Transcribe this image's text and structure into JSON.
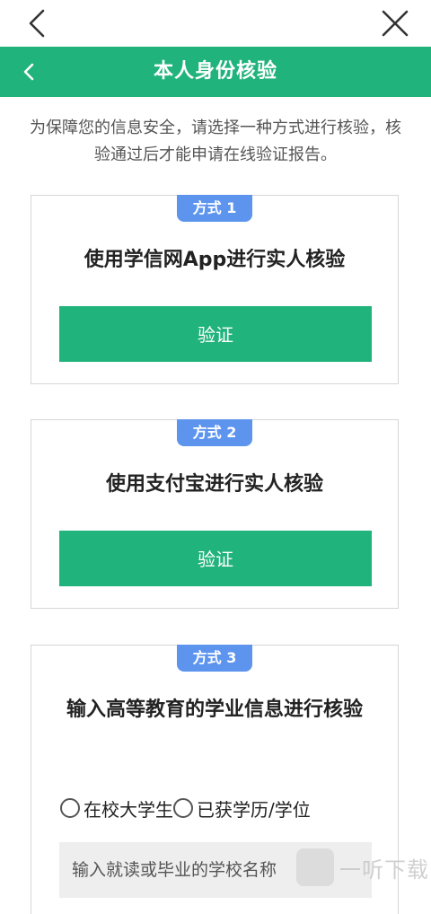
{
  "header": {
    "title": "本人身份核验"
  },
  "intro": {
    "text": "为保障您的信息安全，请选择一种方式进行核验，核验通过后才能申请在线验证报告。"
  },
  "methods": [
    {
      "badge": "方式 1",
      "title": "使用学信网App进行实人核验",
      "button_label": "验证"
    },
    {
      "badge": "方式 2",
      "title": "使用支付宝进行实人核验",
      "button_label": "验证"
    },
    {
      "badge": "方式 3",
      "title": "输入高等教育的学业信息进行核验",
      "radio_options": [
        "在校大学生",
        "已获学历/学位"
      ],
      "school_input": {
        "placeholder": "输入就读或毕业的学校名称",
        "value": ""
      }
    }
  ],
  "watermark": {
    "text": "一听下载"
  },
  "colors": {
    "primary_green": "#21b37c",
    "badge_blue": "#5d94ee"
  },
  "icons": {
    "outer_back": "chevron-left-icon",
    "outer_close": "close-icon",
    "header_back": "chevron-left-icon"
  }
}
